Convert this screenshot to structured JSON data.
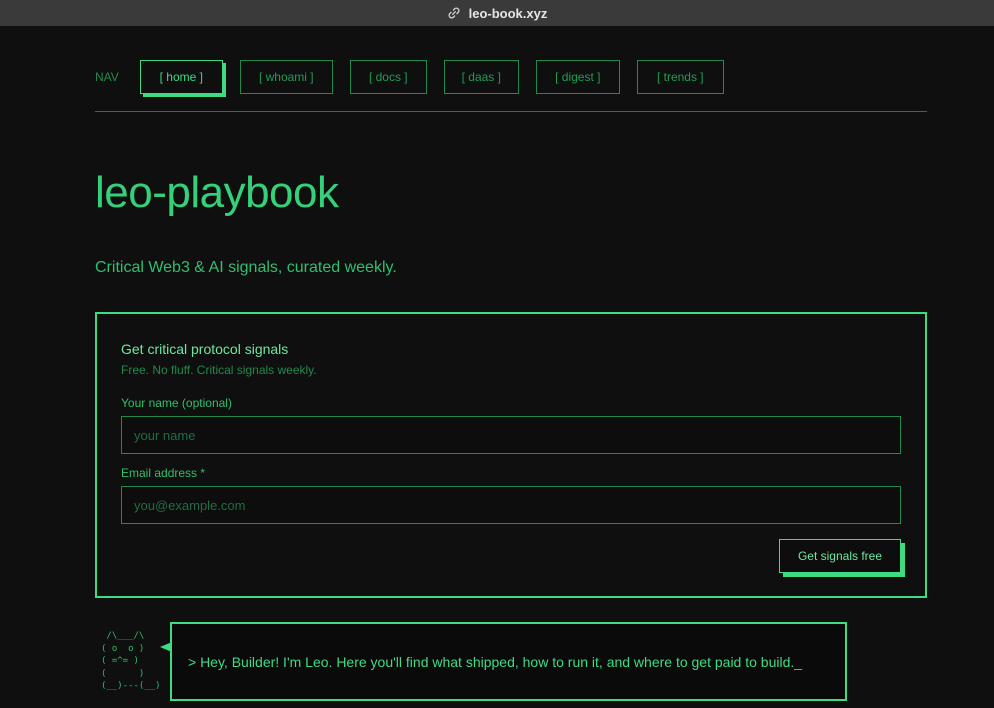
{
  "browser": {
    "url": "leo-book.xyz",
    "icon": "link-icon"
  },
  "nav": {
    "label": "NAV",
    "items": [
      {
        "label": "[ home ]",
        "active": true
      },
      {
        "label": "[ whoami ]",
        "active": false
      },
      {
        "label": "[ docs ]",
        "active": false
      },
      {
        "label": "[ daas ]",
        "active": false
      },
      {
        "label": "[ digest ]",
        "active": false
      },
      {
        "label": "[ trends ]",
        "active": false
      }
    ]
  },
  "hero": {
    "title": "leo-playbook",
    "subtitle": "Critical Web3 & AI signals, curated weekly."
  },
  "signup": {
    "title": "Get critical protocol signals",
    "description": "Free. No fluff. Critical signals weekly.",
    "name_label": "Your name (optional)",
    "name_placeholder": "your name",
    "name_value": "",
    "email_label": "Email address *",
    "email_placeholder": "you@example.com",
    "email_value": "",
    "submit_label": "Get signals free"
  },
  "mascot": {
    "ascii": " /\\___/\\\n( o  o )\n( =^= )\n(      )\n(__)---(__)"
  },
  "greeting": {
    "text": "> Hey, Builder! I'm Leo. Here you'll find what shipped, how to run it, and where to get paid to build._"
  },
  "colors": {
    "background": "#0f0f0f",
    "accent": "#3ddc84",
    "muted": "#1f8a4e",
    "topbar": "#3a3a3a"
  }
}
